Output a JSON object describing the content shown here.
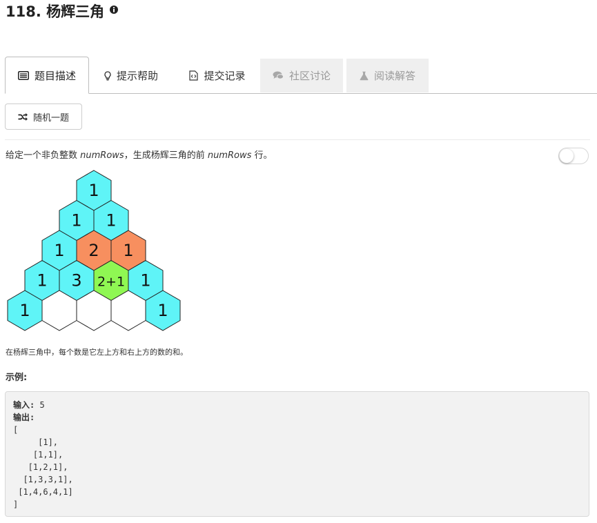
{
  "problem": {
    "title": "118. 杨辉三角"
  },
  "tabs": [
    {
      "label": "题目描述",
      "icon": "description-icon",
      "state": "active"
    },
    {
      "label": "提示帮助",
      "icon": "lightbulb-icon",
      "state": "normal"
    },
    {
      "label": "提交记录",
      "icon": "code-file-icon",
      "state": "normal"
    },
    {
      "label": "社区讨论",
      "icon": "comments-icon",
      "state": "disabled"
    },
    {
      "label": "阅读解答",
      "icon": "flask-icon",
      "state": "disabled"
    }
  ],
  "random_button": {
    "label": "随机一题",
    "icon": "shuffle-icon"
  },
  "description": {
    "prefix": "给定一个非负整数 ",
    "var1": "numRows",
    "middle": "，生成杨辉三角的前 ",
    "var2": "numRows",
    "suffix": " 行。"
  },
  "toggle": {
    "state": "off"
  },
  "figure": {
    "rows": [
      [
        "1"
      ],
      [
        "1",
        "1"
      ],
      [
        "1",
        "2",
        "1"
      ],
      [
        "1",
        "3",
        "2+1",
        "1"
      ],
      [
        "1",
        "",
        "",
        "",
        "1"
      ]
    ],
    "colors": {
      "cyan": "#5ff4f7",
      "orange": "#f78f5f",
      "green": "#8ff753",
      "white": "#ffffff"
    }
  },
  "note": "在杨辉三角中，每个数是它左上方和右上方的数的和。",
  "example": {
    "heading": "示例:",
    "input_label": "输入:",
    "input_value": " 5",
    "output_label": "输出:",
    "lines": [
      "[",
      "     [1],",
      "    [1,1],",
      "   [1,2,1],",
      "  [1,3,3,1],",
      " [1,4,6,4,1]",
      "]"
    ]
  }
}
